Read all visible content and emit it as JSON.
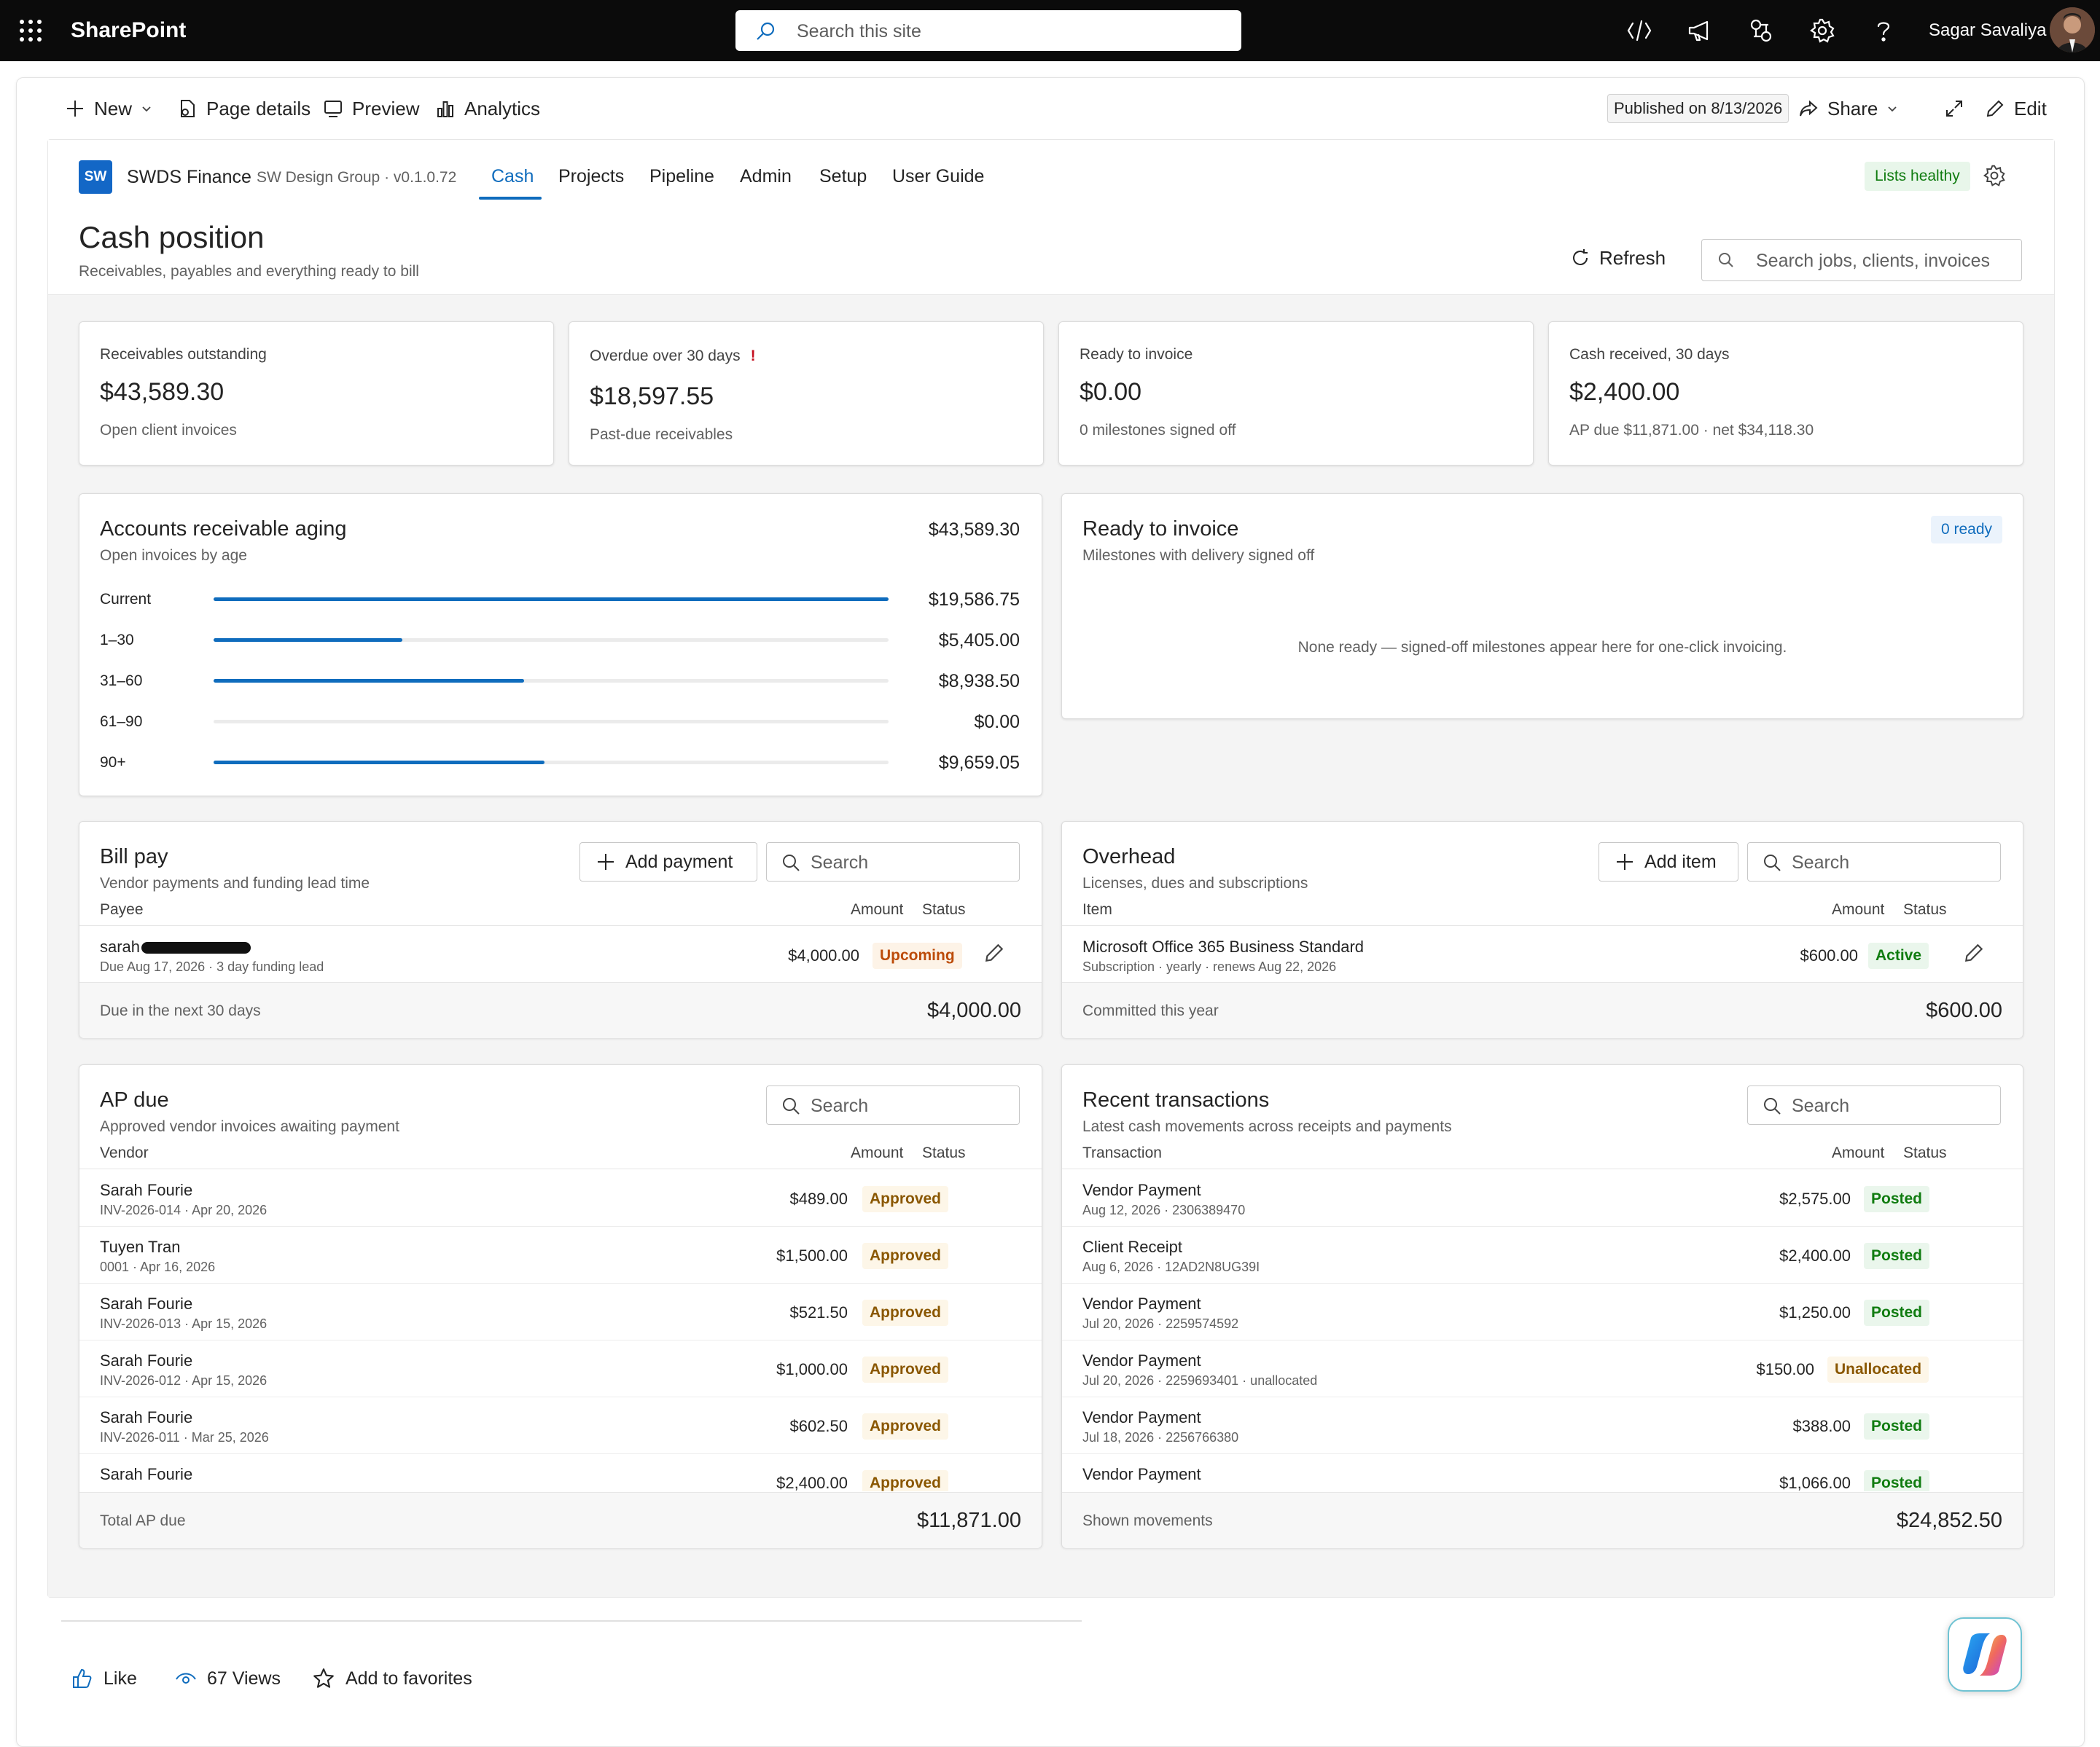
{
  "suite": {
    "brand": "SharePoint",
    "search_placeholder": "Search this site",
    "user_name": "Sagar Savaliya",
    "icons": [
      "waffle-icon",
      "code-icon",
      "megaphone-icon",
      "share-connect-icon",
      "gear-icon",
      "help-icon"
    ]
  },
  "commands": {
    "new": "New",
    "page_details": "Page details",
    "preview": "Preview",
    "analytics": "Analytics",
    "published": "Published on 8/13/2026",
    "share": "Share",
    "edit": "Edit"
  },
  "app": {
    "logo": "SW",
    "name": "SWDS Finance",
    "org": "SW Design Group · v0.1.0.72",
    "tabs": [
      "Cash",
      "Projects",
      "Pipeline",
      "Admin",
      "Setup",
      "User Guide"
    ],
    "active_tab": "Cash",
    "lists_status": "Lists healthy",
    "accent": "#0f6cbd"
  },
  "page": {
    "title": "Cash position",
    "subtitle": "Receivables, payables and everything ready to bill",
    "refresh": "Refresh",
    "search_placeholder": "Search jobs, clients, invoices"
  },
  "kpis": [
    {
      "label": "Receivables outstanding",
      "value": "$43,589.30",
      "sub": "Open client invoices",
      "warning": ""
    },
    {
      "label": "Overdue over 30 days",
      "value": "$18,597.55",
      "sub": "Past-due receivables",
      "warning": "!"
    },
    {
      "label": "Ready to invoice",
      "value": "$0.00",
      "sub": "0 milestones signed off",
      "warning": ""
    },
    {
      "label": "Cash received, 30 days",
      "value": "$2,400.00",
      "sub": "AP due $11,871.00 · net $34,118.30",
      "warning": ""
    }
  ],
  "aging": {
    "title": "Accounts receivable aging",
    "subtitle": "Open invoices by age",
    "total": "$43,589.30",
    "rows": [
      {
        "label": "Current",
        "value": "$19,586.75",
        "fraction": 1.0
      },
      {
        "label": "1–30",
        "value": "$5,405.00",
        "fraction": 0.28
      },
      {
        "label": "31–60",
        "value": "$8,938.50",
        "fraction": 0.46
      },
      {
        "label": "61–90",
        "value": "$0.00",
        "fraction": 0.0
      },
      {
        "label": "90+",
        "value": "$9,659.05",
        "fraction": 0.49
      }
    ]
  },
  "ready": {
    "title": "Ready to invoice",
    "subtitle": "Milestones with delivery signed off",
    "badge": "0 ready",
    "empty": "None ready — signed-off milestones appear here for one-click invoicing."
  },
  "billpay": {
    "title": "Bill pay",
    "subtitle": "Vendor payments and funding lead time",
    "add": "Add payment",
    "search_placeholder": "Search",
    "columns": {
      "name": "Payee",
      "amount": "Amount",
      "status": "Status"
    },
    "rows": [
      {
        "name": "sarah",
        "meta": "Due Aug 17, 2026 · 3 day funding lead",
        "amount": "$4,000.00",
        "status": "Upcoming"
      }
    ],
    "footer_label": "Due in the next 30 days",
    "footer_value": "$4,000.00"
  },
  "overhead": {
    "title": "Overhead",
    "subtitle": "Licenses, dues and subscriptions",
    "add": "Add item",
    "search_placeholder": "Search",
    "columns": {
      "name": "Item",
      "amount": "Amount",
      "status": "Status"
    },
    "rows": [
      {
        "name": "Microsoft Office 365 Business Standard",
        "meta": "Subscription · yearly · renews Aug 22, 2026",
        "amount": "$600.00",
        "status": "Active"
      }
    ],
    "footer_label": "Committed this year",
    "footer_value": "$600.00"
  },
  "ap": {
    "title": "AP due",
    "subtitle": "Approved vendor invoices awaiting payment",
    "search_placeholder": "Search",
    "columns": {
      "name": "Vendor",
      "amount": "Amount",
      "status": "Status"
    },
    "rows": [
      {
        "name": "Sarah Fourie",
        "meta": "INV-2026-014 · Apr 20, 2026",
        "amount": "$489.00",
        "status": "Approved"
      },
      {
        "name": "Tuyen Tran",
        "meta": "0001 · Apr 16, 2026",
        "amount": "$1,500.00",
        "status": "Approved"
      },
      {
        "name": "Sarah Fourie",
        "meta": "INV-2026-013 · Apr 15, 2026",
        "amount": "$521.50",
        "status": "Approved"
      },
      {
        "name": "Sarah Fourie",
        "meta": "INV-2026-012 · Apr 15, 2026",
        "amount": "$1,000.00",
        "status": "Approved"
      },
      {
        "name": "Sarah Fourie",
        "meta": "INV-2026-011 · Mar 25, 2026",
        "amount": "$602.50",
        "status": "Approved"
      },
      {
        "name": "Sarah Fourie",
        "meta": "",
        "amount": "$2,400.00",
        "status": "Approved"
      }
    ],
    "footer_label": "Total AP due",
    "footer_value": "$11,871.00"
  },
  "transactions": {
    "title": "Recent transactions",
    "subtitle": "Latest cash movements across receipts and payments",
    "search_placeholder": "Search",
    "columns": {
      "name": "Transaction",
      "amount": "Amount",
      "status": "Status"
    },
    "rows": [
      {
        "name": "Vendor Payment",
        "meta": "Aug 12, 2026 · 2306389470",
        "amount": "$2,575.00",
        "status": "Posted"
      },
      {
        "name": "Client Receipt",
        "meta": "Aug 6, 2026 · 12AD2N8UG39I",
        "amount": "$2,400.00",
        "status": "Posted"
      },
      {
        "name": "Vendor Payment",
        "meta": "Jul 20, 2026 · 2259574592",
        "amount": "$1,250.00",
        "status": "Posted"
      },
      {
        "name": "Vendor Payment",
        "meta": "Jul 20, 2026 · 2259693401 · unallocated",
        "amount": "$150.00",
        "status": "Unallocated"
      },
      {
        "name": "Vendor Payment",
        "meta": "Jul 18, 2026 · 2256766380",
        "amount": "$388.00",
        "status": "Posted"
      },
      {
        "name": "Vendor Payment",
        "meta": "",
        "amount": "$1,066.00",
        "status": "Posted"
      }
    ],
    "footer_label": "Shown movements",
    "footer_value": "$24,852.50"
  },
  "social": {
    "like": "Like",
    "views": "67 Views",
    "favorites": "Add to favorites"
  }
}
